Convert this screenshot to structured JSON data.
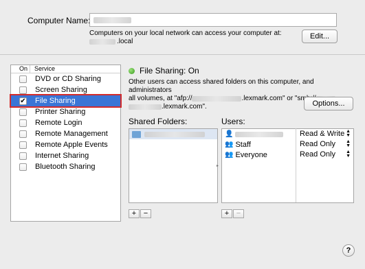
{
  "computer_name": {
    "label": "Computer Name:",
    "note": "Computers on your local network can access your computer at:",
    "local_suffix": ".local",
    "edit_label": "Edit..."
  },
  "services": {
    "headers": {
      "on": "On",
      "service": "Service"
    },
    "items": [
      {
        "label": "DVD or CD Sharing",
        "checked": false
      },
      {
        "label": "Screen Sharing",
        "checked": false
      },
      {
        "label": "File Sharing",
        "checked": true,
        "selected": true
      },
      {
        "label": "Printer Sharing",
        "checked": false
      },
      {
        "label": "Remote Login",
        "checked": false
      },
      {
        "label": "Remote Management",
        "checked": false
      },
      {
        "label": "Remote Apple Events",
        "checked": false
      },
      {
        "label": "Internet Sharing",
        "checked": false
      },
      {
        "label": "Bluetooth Sharing",
        "checked": false
      }
    ]
  },
  "file_sharing": {
    "status": "File Sharing: On",
    "status_color": "#3a9a20",
    "desc_line1": "Other users can access shared folders on this computer, and administrators",
    "desc_line2a": "all volumes, at \"afp://",
    "desc_line2b": ".lexmark.com\" or \"smb://",
    "desc_line3": ".lexmark.com\".",
    "options_label": "Options..."
  },
  "shared_folders": {
    "label": "Shared Folders:"
  },
  "users": {
    "label": "Users:",
    "rows": [
      {
        "name": "",
        "permission": "Read & Write"
      },
      {
        "name": "Staff",
        "permission": "Read Only"
      },
      {
        "name": "Everyone",
        "permission": "Read Only"
      }
    ]
  },
  "buttons": {
    "add": "+",
    "remove": "−",
    "help": "?"
  },
  "colors": {
    "selection": "#3a75d6",
    "highlight_border": "#d32a2a"
  }
}
